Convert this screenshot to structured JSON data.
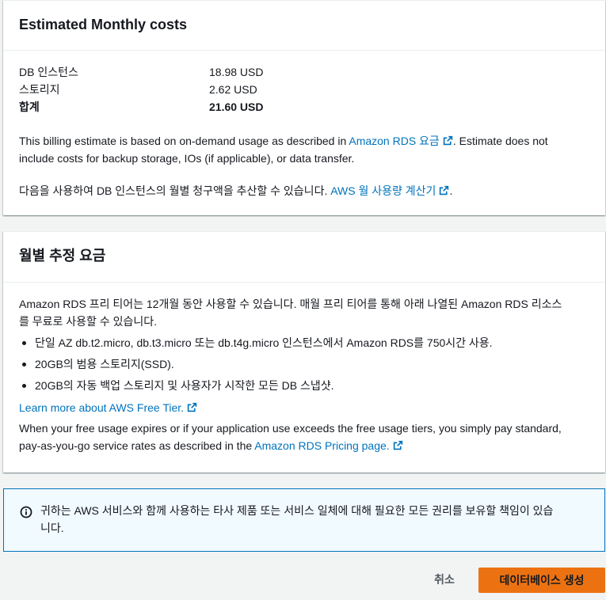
{
  "costs_panel": {
    "title": "Estimated Monthly costs",
    "rows": [
      {
        "label": "DB 인스턴스",
        "value": "18.98 USD"
      },
      {
        "label": "스토리지",
        "value": "2.62 USD"
      },
      {
        "label": "합계",
        "value": "21.60 USD"
      }
    ],
    "estimate_text_before": "This billing estimate is based on on-demand usage as described in ",
    "estimate_link": "Amazon RDS 요금",
    "estimate_text_after_line1": ". Estimate does not",
    "estimate_text_line2": "include costs for backup storage, IOs (if applicable), or data transfer.",
    "calculator_text": "다음을 사용하여 DB 인스턴스의 월별 청구액을 추산할 수 있습니다. ",
    "calculator_link": "AWS 월 사용량 계산기",
    "calculator_period": "."
  },
  "free_panel": {
    "title": "월별 추정 요금",
    "intro_line1": "Amazon RDS 프리 티어는 12개월 동안 사용할 수 있습니다. 매월 프리 티어를 통해 아래 나열된 Amazon RDS 리소스",
    "intro_line2": "를 무료로 사용할 수 있습니다.",
    "bullets": [
      "단일 AZ db.t2.micro, db.t3.micro 또는 db.t4g.micro 인스턴스에서 Amazon RDS를 750시간 사용.",
      "20GB의 범용 스토리지(SSD).",
      "20GB의 자동 백업 스토리지 및 사용자가 시작한 모든 DB 스냅샷."
    ],
    "learn_more_link": "Learn more about AWS Free Tier.",
    "pricing_line1": "When your free usage expires or if your application use exceeds the free usage tiers, you simply pay standard,",
    "pricing_line2_before": "pay-as-you-go service rates as described in the ",
    "pricing_link": "Amazon RDS Pricing page."
  },
  "alert": {
    "line1": "귀하는 AWS 서비스와 함께 사용하는 타사 제품 또는 서비스 일체에 대해 필요한 모든 권리를 보유할 책임이 있습",
    "line2": "니다."
  },
  "footer": {
    "cancel_label": "취소",
    "create_label": "데이터베이스 생성"
  },
  "colors": {
    "link": "#0073bb",
    "primary_button": "#ec7211",
    "alert_background": "#f1faff",
    "alert_border": "#0073bb"
  },
  "icons": {
    "external_link": "external-link-icon",
    "info": "info-icon"
  }
}
